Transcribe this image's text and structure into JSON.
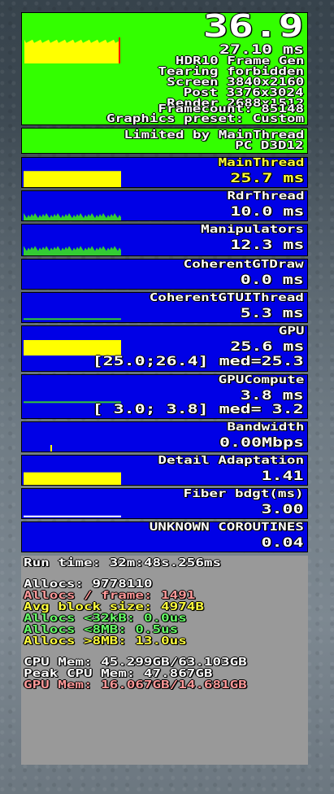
{
  "fps": {
    "value": "36.9",
    "frame_time": "27.10 ms",
    "lines": [
      "HDR10 Frame Gen",
      "Tearing forbidden",
      "Screen 3840x2160",
      "Post 3376x3024",
      "Render 2688x1512",
      "Framecount: 85148",
      "Graphics preset: Custom"
    ],
    "graph_fill": 0.62,
    "colors": {
      "panel": "#33ff00",
      "graph": "#ffff00",
      "marker": "#ff0000"
    }
  },
  "limited": {
    "line1": "Limited by MainThread",
    "line2": "PC D3D12"
  },
  "panels": [
    {
      "key": "mainthread",
      "title": "MainThread",
      "value": "25.7 ms",
      "highlight": true,
      "graph": "yellow-full",
      "fill": 0.85
    },
    {
      "key": "rdrthread",
      "title": "RdrThread",
      "value": "10.0 ms",
      "highlight": false,
      "graph": "green-low",
      "fill": 0.32
    },
    {
      "key": "manipulators",
      "title": "Manipulators",
      "value": "12.3 ms",
      "highlight": false,
      "graph": "green-low",
      "fill": 0.4
    },
    {
      "key": "coherentgtdraw",
      "title": "CoherentGTDraw",
      "value": "0.0 ms",
      "highlight": false,
      "graph": "none",
      "fill": 0
    },
    {
      "key": "coherentgtuithread",
      "title": "CoherentGTUIThread",
      "value": "5.3 ms",
      "highlight": false,
      "graph": "green-line",
      "fill": 0.17
    },
    {
      "key": "gpu",
      "title": "GPU",
      "value": "25.6 ms",
      "range": "[25.0;26.4] med=25.3",
      "highlight": false,
      "graph": "yellow-full",
      "fill": 0.82
    },
    {
      "key": "gpucompute",
      "title": "GPUCompute",
      "value": "3.8 ms",
      "range": "[ 3.0; 3.8] med= 3.2",
      "highlight": false,
      "graph": "green-line",
      "fill": 0.12
    },
    {
      "key": "bandwidth",
      "title": "Bandwidth",
      "value": "0.00Mbps",
      "highlight": false,
      "graph": "tick",
      "fill": 0
    },
    {
      "key": "detail",
      "title": "Detail Adaptation",
      "value": "1.41",
      "highlight": false,
      "graph": "yellow-bar",
      "fill": 0.7
    },
    {
      "key": "fiber",
      "title": "Fiber bdgt(ms)",
      "value": "3.00",
      "highlight": false,
      "graph": "white-line",
      "fill": 0.1
    },
    {
      "key": "coroutines",
      "title": "UNKNOWN COROUTINES",
      "value": "0.04",
      "highlight": false,
      "graph": "none",
      "fill": 0
    }
  ],
  "memory": {
    "run_time": "Run time: 32m:48s.256ms",
    "allocs": "Allocs: 9778110",
    "allocs_per_frame": "Allocs / frame: 1491",
    "avg_block": "Avg block size: 4974B",
    "allocs_32k": "Allocs <32kB: 0.0us",
    "allocs_8mb_lt": "Allocs <8MB: 0.5us",
    "allocs_8mb_gt": "Allocs >8MB: 13.0us",
    "cpu_mem": "CPU Mem: 45.299GB/63.103GB",
    "peak_cpu_mem": "Peak CPU Mem: 47.867GB",
    "gpu_mem": "GPU Mem: 16.067GB/14.681GB",
    "colors": {
      "white": "#ffffff",
      "pink": "#ff9999",
      "yellow": "#ffff3c",
      "green": "#66ff66"
    }
  }
}
